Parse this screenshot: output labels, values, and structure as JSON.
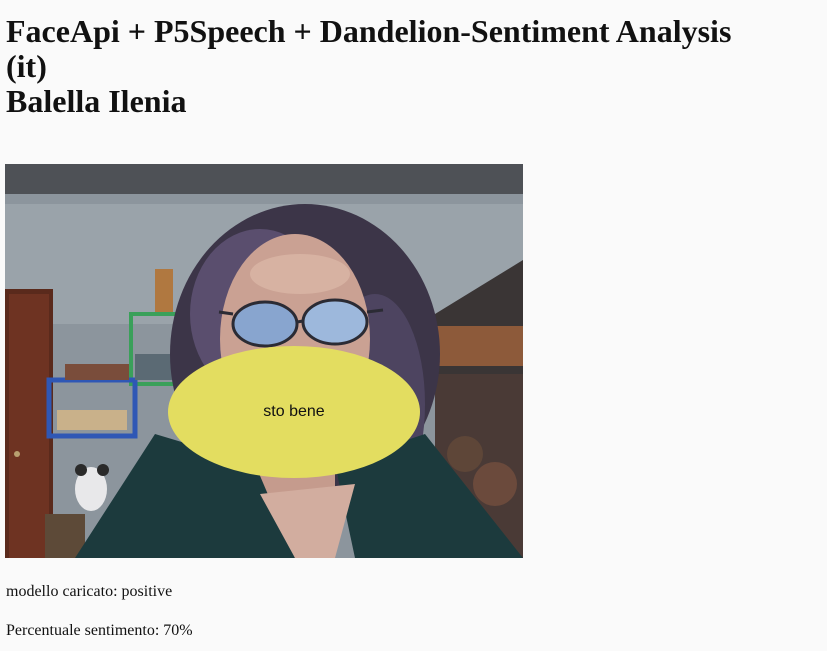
{
  "header": {
    "title_line1": "FaceApi + P5Speech + Dandelion-Sentiment Analysis",
    "title_line2": "(it)",
    "author": "Balella Ilenia"
  },
  "webcam": {
    "speech_text": "sto bene",
    "bubble_color": "#e3dd60"
  },
  "status": {
    "model_label": "modello caricato:",
    "model_value": "positive",
    "percent_label": "Percentuale sentimento:",
    "percent_value": "70%"
  }
}
